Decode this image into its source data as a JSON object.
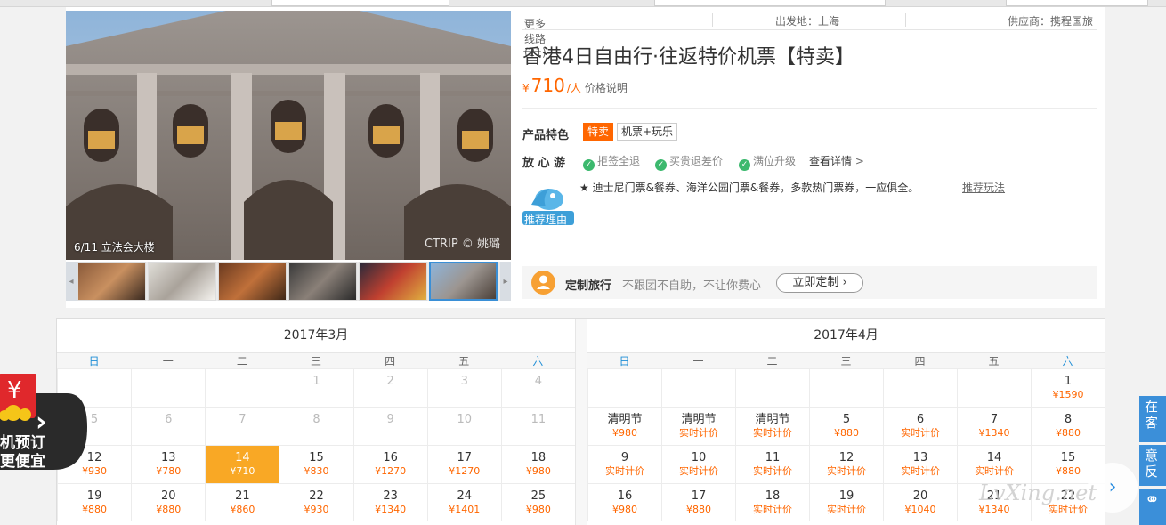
{
  "gallery": {
    "caption": "6/11 立法会大楼",
    "watermark": "CTRIP © 姚璐"
  },
  "meta": {
    "more_routes": "更多线路(21)",
    "departure": "出发地：上海",
    "supplier": "供应商：携程国旅"
  },
  "product": {
    "title": "香港4日自由行·往返特价机票【特卖】",
    "currency": "¥",
    "price": "710",
    "per_person": "/人",
    "price_note": "价格说明"
  },
  "features": {
    "label": "产品特色",
    "tags": [
      "特卖",
      "机票+玩乐"
    ]
  },
  "assurance": {
    "label": "放 心 游",
    "items": [
      "拒签全退",
      "买贵退差价",
      "满位升级"
    ],
    "detail_link": "查看详情",
    "detail_arrow": ">"
  },
  "reason": {
    "badge": "推荐理由",
    "text": "★ 迪士尼门票&餐券、海洋公园门票&餐券，多款热门票券，一应俱全。",
    "link": "推荐玩法"
  },
  "custom_travel": {
    "title": "定制旅行",
    "desc": "不跟团不自助，不让你费心",
    "button": "立即定制 ›"
  },
  "calendar": {
    "weekdays": [
      "日",
      "一",
      "二",
      "三",
      "四",
      "五",
      "六"
    ],
    "months": [
      {
        "title": "2017年3月",
        "rows": [
          [
            null,
            null,
            null,
            {
              "d": "1",
              "past": true
            },
            {
              "d": "2",
              "past": true
            },
            {
              "d": "3",
              "past": true
            },
            {
              "d": "4",
              "past": true
            }
          ],
          [
            {
              "d": "5",
              "past": true
            },
            {
              "d": "6",
              "past": true
            },
            {
              "d": "7",
              "past": true
            },
            {
              "d": "8",
              "past": true
            },
            {
              "d": "9",
              "past": true
            },
            {
              "d": "10",
              "past": true
            },
            {
              "d": "11",
              "past": true
            }
          ],
          [
            {
              "d": "12",
              "p": "¥930"
            },
            {
              "d": "13",
              "p": "¥780"
            },
            {
              "d": "14",
              "p": "¥710",
              "sel": true
            },
            {
              "d": "15",
              "p": "¥830"
            },
            {
              "d": "16",
              "p": "¥1270"
            },
            {
              "d": "17",
              "p": "¥1270"
            },
            {
              "d": "18",
              "p": "¥980"
            }
          ],
          [
            {
              "d": "19",
              "p": "¥880"
            },
            {
              "d": "20",
              "p": "¥880"
            },
            {
              "d": "21",
              "p": "¥860"
            },
            {
              "d": "22",
              "p": "¥930"
            },
            {
              "d": "23",
              "p": "¥1340"
            },
            {
              "d": "24",
              "p": "¥1401"
            },
            {
              "d": "25",
              "p": "¥980"
            }
          ]
        ]
      },
      {
        "title": "2017年4月",
        "rows": [
          [
            null,
            null,
            null,
            null,
            null,
            null,
            {
              "d": "1",
              "p": "¥1590"
            }
          ],
          [
            {
              "d": "清明节",
              "p": "¥980"
            },
            {
              "d": "清明节",
              "p": "实时计价"
            },
            {
              "d": "清明节",
              "p": "实时计价"
            },
            {
              "d": "5",
              "p": "¥880"
            },
            {
              "d": "6",
              "p": "实时计价"
            },
            {
              "d": "7",
              "p": "¥1340"
            },
            {
              "d": "8",
              "p": "¥880"
            }
          ],
          [
            {
              "d": "9",
              "p": "实时计价"
            },
            {
              "d": "10",
              "p": "实时计价"
            },
            {
              "d": "11",
              "p": "实时计价"
            },
            {
              "d": "12",
              "p": "实时计价"
            },
            {
              "d": "13",
              "p": "实时计价"
            },
            {
              "d": "14",
              "p": "实时计价"
            },
            {
              "d": "15",
              "p": "¥880"
            }
          ],
          [
            {
              "d": "16",
              "p": "¥980"
            },
            {
              "d": "17",
              "p": "¥880"
            },
            {
              "d": "18",
              "p": "实时计价"
            },
            {
              "d": "19",
              "p": "实时计价"
            },
            {
              "d": "20",
              "p": "¥1040"
            },
            {
              "d": "21",
              "p": "¥1340"
            },
            {
              "d": "22",
              "p": "实时计价"
            }
          ]
        ]
      }
    ]
  },
  "promo": {
    "symbol": "¥",
    "line1": "机预订",
    "line2": "更便宜",
    "arrow": "›"
  },
  "right_widgets": {
    "w1": "在客",
    "w2": "意反"
  },
  "site_watermark": "LvXing.net",
  "colors": {
    "accent": "#ff6600",
    "selected": "#f9a825",
    "link_blue": "#1f8ed6",
    "widget_blue": "#3b8fd9"
  }
}
